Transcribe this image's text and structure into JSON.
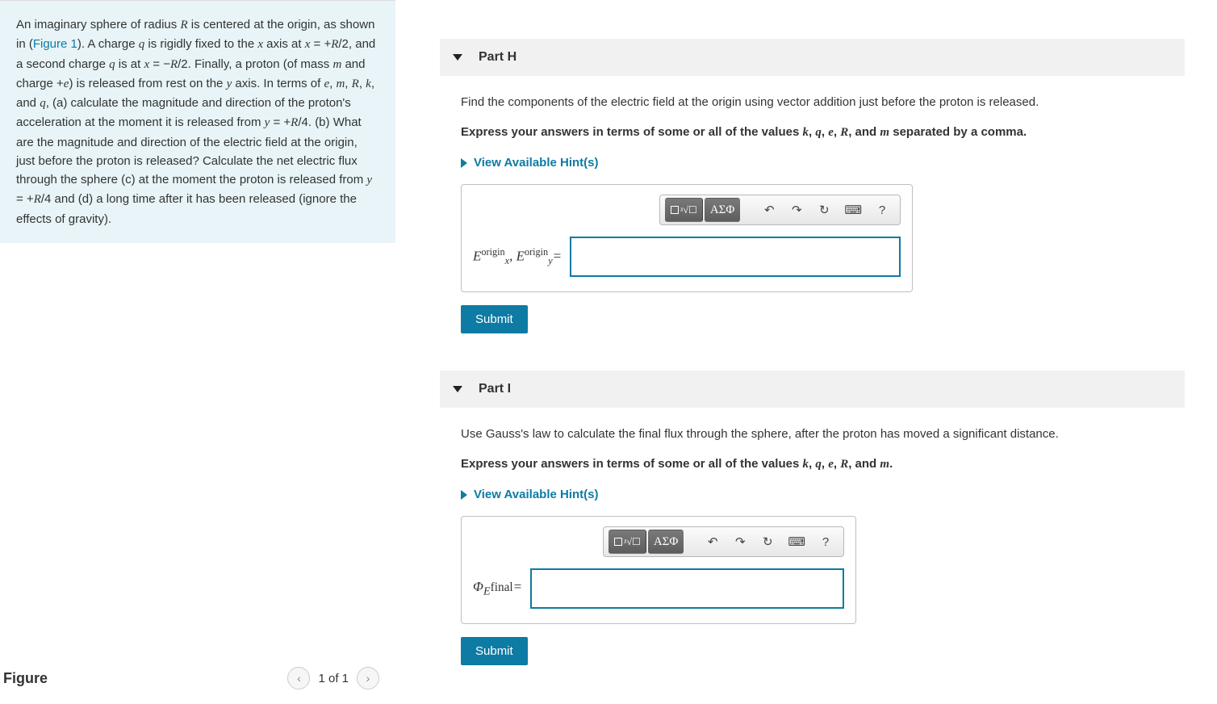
{
  "problem": {
    "text_html": "An imaginary sphere of radius <span class='mathvar'>R</span> is centered at the origin, as shown in (<span class='figure-link'>Figure 1</span>). A charge <span class='mathvar'>q</span> is rigidly fixed to the <span class='mathvar'>x</span> axis at <span class='mathvar'>x</span> = +<span class='mathvar'>R</span>/2, and a second charge <span class='mathvar'>q</span> is at <span class='mathvar'>x</span> = −<span class='mathvar'>R</span>/2. Finally, a proton (of mass <span class='mathvar'>m</span> and charge +<span class='mathvar'>e</span>) is released from rest on the <span class='mathvar'>y</span> axis. In terms of <span class='mathvar'>e</span>, <span class='mathvar'>m</span>, <span class='mathvar'>R</span>, <span class='mathvar'>k</span>, and <span class='mathvar'>q</span>, (a) calculate the magnitude and direction of the proton's acceleration at the moment it is released from <span class='mathvar'>y</span> = +<span class='mathvar'>R</span>/4. (b) What are the magnitude and direction of the electric field at the origin, just before the proton is released? Calculate the net electric flux through the sphere (c) at the moment the proton is released from <span class='mathvar'>y</span> = +<span class='mathvar'>R</span>/4 and (d) a long time after it has been released (ignore the effects of gravity)."
  },
  "figure": {
    "label": "Figure",
    "pager": "1 of 1"
  },
  "hints_label": "View Available Hint(s)",
  "submit_label": "Submit",
  "toolbar": {
    "template_glyph": "■",
    "root_glyph": "ᵡ√☐",
    "greek_label": "ΑΣΦ",
    "undo": "↶",
    "redo": "↷",
    "reset": "↻",
    "keyboard": "⌨",
    "help": "?"
  },
  "parts": {
    "h": {
      "title": "Part H",
      "prompt": "Find the components of the electric field at the origin using vector addition just before the proton is released.",
      "instruction_html": "Express your answers in terms of some or all of the values <span class='mathvar'>k</span>, <span class='mathvar'>q</span>, <span class='mathvar'>e</span>, <span class='mathvar'>R</span>, and <span class='mathvar'>m</span> separated by a comma.",
      "answer_label_html": "<span class='mathvar'>E</span><span class='sup'>origin</span><span class='sub'>x</span>, <span class='mathvar'>E</span><span class='sup'>origin</span><span class='sub'>y</span>="
    },
    "i": {
      "title": "Part I",
      "prompt": "Use Gauss's law to calculate the final flux through the sphere, after the proton has moved a significant distance.",
      "instruction_html": "Express your answers in terms of some or all of the values <span class='mathvar'>k</span>, <span class='mathvar'>q</span>, <span class='mathvar'>e</span>, <span class='mathvar'>R</span>, and <span class='mathvar'>m</span>.",
      "answer_label_html": "Φ<sub style='font-style:italic'>E</sub><span style='font-style:normal;font-size:0.9em'>final</span>="
    }
  }
}
